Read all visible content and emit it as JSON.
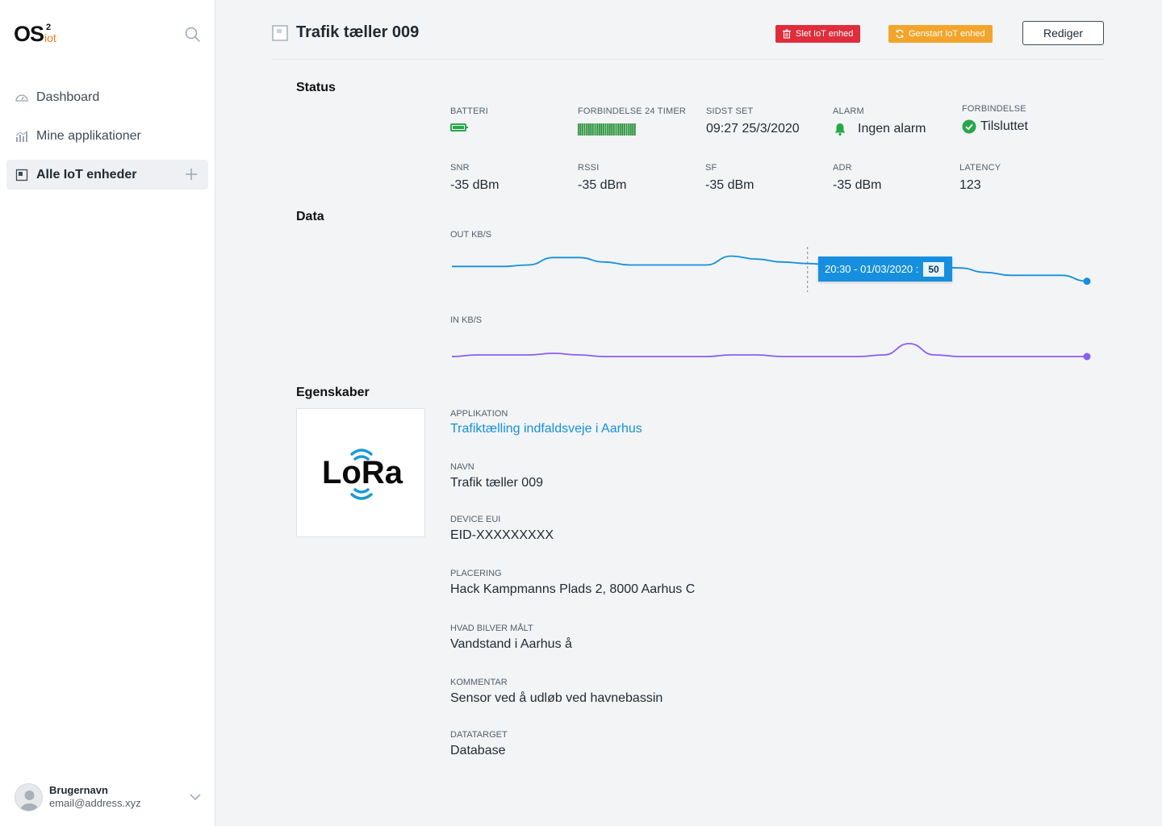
{
  "logo": {
    "main": "OS",
    "sup": "2",
    "sub": "iot"
  },
  "sidebar": {
    "items": [
      {
        "label": "Dashboard"
      },
      {
        "label": "Mine applikationer"
      },
      {
        "label": "Alle IoT enheder"
      }
    ]
  },
  "user": {
    "name": "Brugernavn",
    "email": "email@address.xyz"
  },
  "header": {
    "title": "Trafik tæller 009",
    "delete_label": "Slet IoT enhed",
    "restart_label": "Genstart IoT enhed",
    "edit_label": "Rediger"
  },
  "colors": {
    "danger": "#e02d3c",
    "warning": "#f2a52a",
    "accent": "#1690de",
    "success": "#27a74a",
    "purple": "#8b5cf6"
  },
  "status": {
    "title": "Status",
    "battery": {
      "label": "BATTERI"
    },
    "connection24": {
      "label": "FORBINDELSE 24 TIMER"
    },
    "last_seen": {
      "label": "SIDST SET",
      "value": "09:27 25/3/2020"
    },
    "alarm": {
      "label": "ALARM",
      "value": "Ingen alarm"
    },
    "connection": {
      "label": "FORBINDELSE",
      "value": "Tilsluttet"
    },
    "snr": {
      "label": "SNR",
      "value": "-35 dBm"
    },
    "rssi": {
      "label": "RSSI",
      "value": "-35 dBm"
    },
    "sf": {
      "label": "SF",
      "value": "-35 dBm"
    },
    "adr": {
      "label": "ADR",
      "value": "-35 dBm"
    },
    "latency": {
      "label": "LATENCY",
      "value": "123"
    }
  },
  "data": {
    "title": "Data",
    "out_label": "OUT KB/S",
    "in_label": "IN KB/S",
    "tooltip": {
      "label": "20:30 - 01/03/2020 :",
      "value": "50"
    }
  },
  "chart_data": [
    {
      "type": "line",
      "series": [
        {
          "values": [
            50,
            50,
            50,
            51,
            56,
            56,
            53,
            51,
            51,
            51,
            51,
            57,
            55,
            53,
            52,
            51,
            50,
            50,
            51,
            50,
            49,
            46,
            44,
            44,
            44,
            40
          ]
        }
      ],
      "xlabel": "",
      "ylabel": "OUT KB/S"
    },
    {
      "type": "line",
      "series": [
        {
          "values": [
            20,
            21,
            21,
            21,
            22,
            21,
            20,
            20,
            20,
            20,
            20,
            21,
            21,
            20,
            20,
            20,
            20,
            21,
            28,
            21,
            20,
            20,
            20,
            20,
            20,
            20
          ]
        }
      ],
      "xlabel": "",
      "ylabel": "IN KB/S"
    }
  ],
  "properties": {
    "title": "Egenskaber",
    "lora_logo": "LoRa",
    "application": {
      "label": "APPLIKATION",
      "value": "Trafiktælling indfaldsveje i Aarhus"
    },
    "name": {
      "label": "NAVN",
      "value": "Trafik tæller 009"
    },
    "eui": {
      "label": "DEVICE EUI",
      "value": "EID-XXXXXXXXX"
    },
    "location": {
      "label": "PLACERING",
      "value": "Hack Kampmanns Plads 2, 8000 Aarhus C"
    },
    "measured": {
      "label": "HVAD BILVER MÅLT",
      "value": "Vandstand i Aarhus å"
    },
    "comment": {
      "label": "KOMMENTAR",
      "value": "Sensor ved å udløb ved havnebassin"
    },
    "datatarget": {
      "label": "DATATARGET",
      "value": "Database"
    }
  }
}
